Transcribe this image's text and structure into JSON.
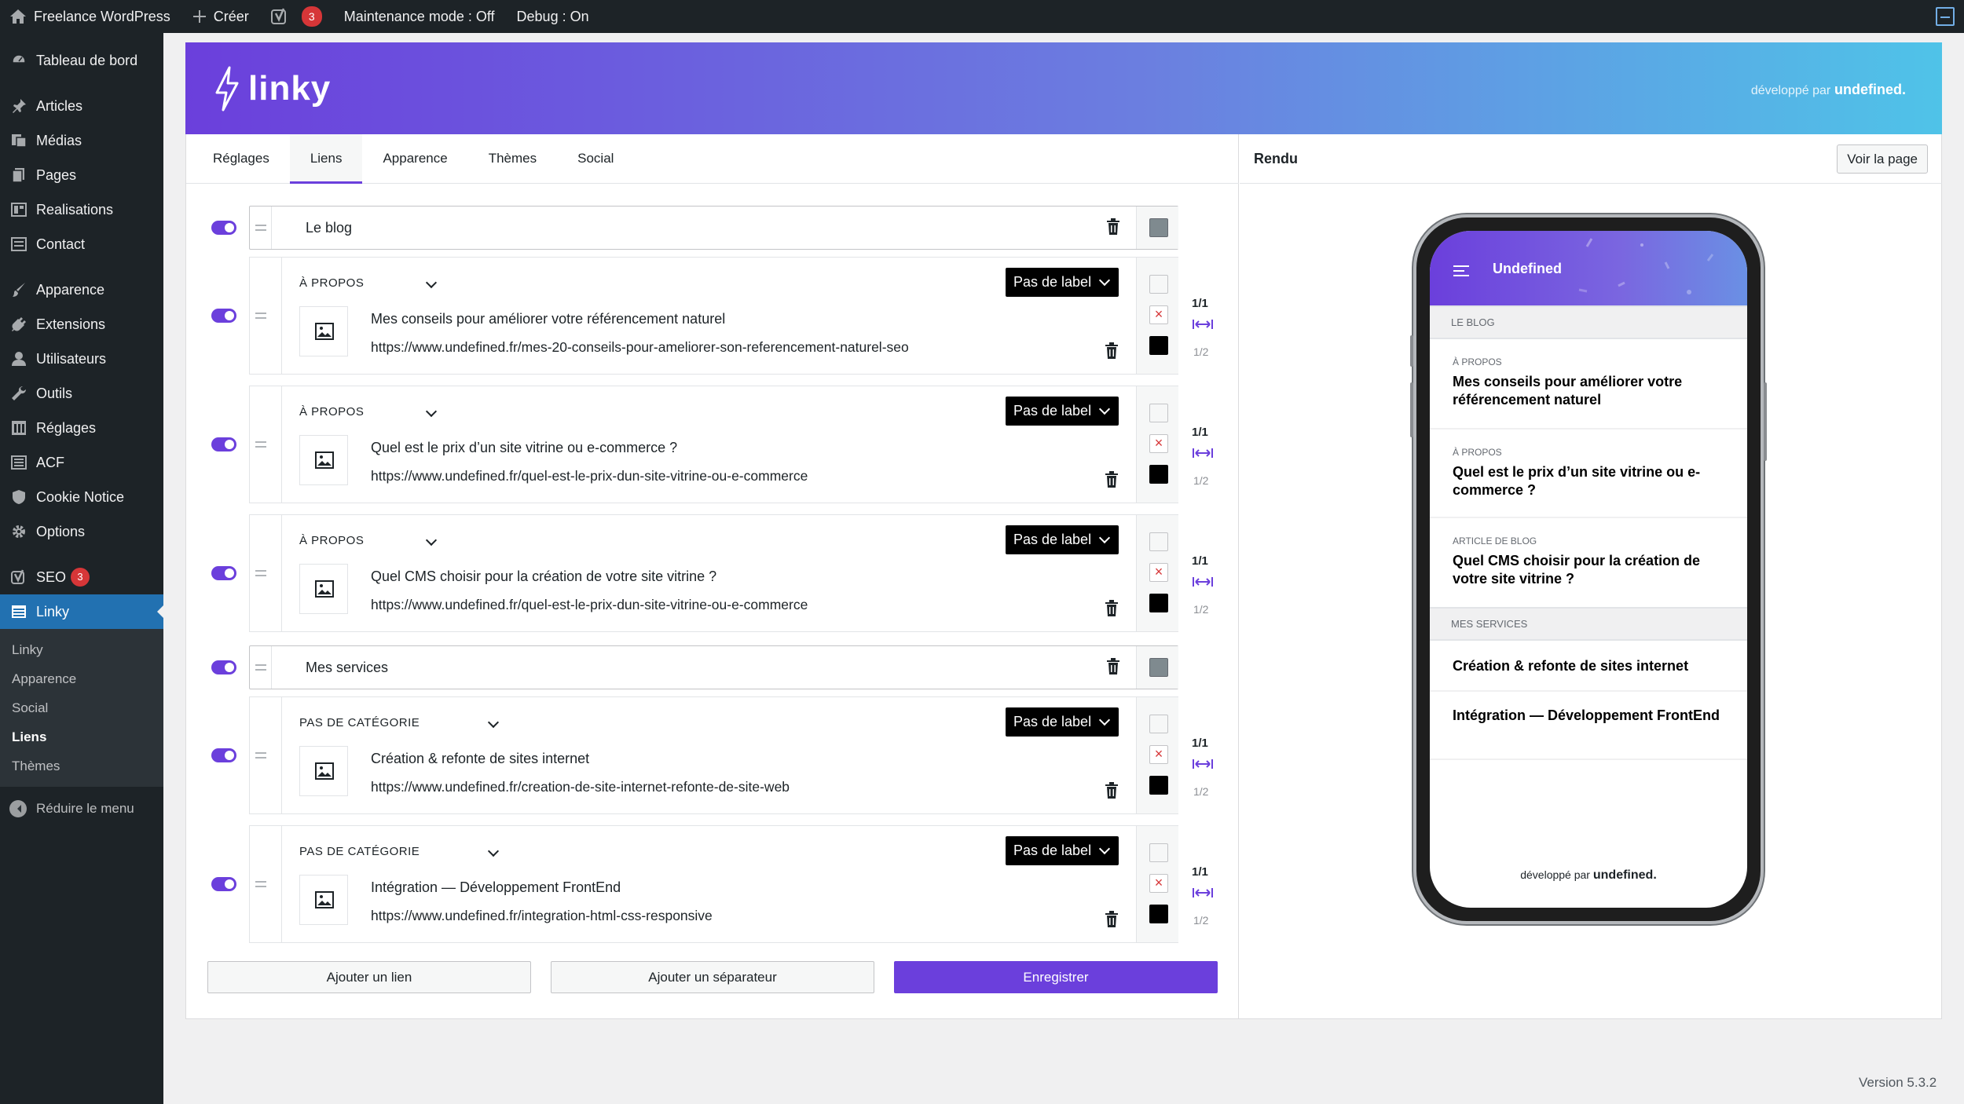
{
  "adminbar": {
    "site_name": "Freelance WordPress",
    "create": "Créer",
    "seo_count": "3",
    "maintenance": "Maintenance mode : Off",
    "debug": "Debug : On"
  },
  "sidebar": {
    "items": [
      {
        "label": "Tableau de bord",
        "icon": "dashboard-icon"
      },
      {
        "label": "Articles",
        "icon": "pin-icon"
      },
      {
        "label": "Médias",
        "icon": "media-icon"
      },
      {
        "label": "Pages",
        "icon": "pages-icon"
      },
      {
        "label": "Realisations",
        "icon": "realisations-icon"
      },
      {
        "label": "Contact",
        "icon": "contact-icon"
      },
      {
        "label": "Apparence",
        "icon": "brush-icon"
      },
      {
        "label": "Extensions",
        "icon": "plugin-icon"
      },
      {
        "label": "Utilisateurs",
        "icon": "users-icon"
      },
      {
        "label": "Outils",
        "icon": "wrench-icon"
      },
      {
        "label": "Réglages",
        "icon": "settings-icon"
      },
      {
        "label": "ACF",
        "icon": "acf-icon"
      },
      {
        "label": "Cookie Notice",
        "icon": "shield-icon"
      },
      {
        "label": "Options",
        "icon": "gear-icon"
      },
      {
        "label": "SEO",
        "icon": "yoast-icon",
        "badge": "3"
      },
      {
        "label": "Linky",
        "icon": "linky-icon"
      }
    ],
    "submenu": [
      "Linky",
      "Apparence",
      "Social",
      "Liens",
      "Thèmes"
    ],
    "collapse": "Réduire le menu"
  },
  "banner": {
    "logo": "linky",
    "credit_prefix": "développé par",
    "credit_brand": "undefined."
  },
  "tabs": [
    "Réglages",
    "Liens",
    "Apparence",
    "Thèmes",
    "Social"
  ],
  "editor": {
    "separators": [
      "Le blog",
      "Mes services"
    ],
    "links": [
      {
        "category": "À PROPOS",
        "label": "Pas de label",
        "title": "Mes conseils pour améliorer votre référencement naturel",
        "url": "https://www.undefined.fr/mes-20-conseils-pour-ameliorer-son-referencement-naturel-seo",
        "width_full": "1/1",
        "width_half": "1/2"
      },
      {
        "category": "À PROPOS",
        "label": "Pas de label",
        "title": "Quel est le prix d’un site vitrine ou e-commerce ?",
        "url": "https://www.undefined.fr/quel-est-le-prix-dun-site-vitrine-ou-e-commerce",
        "width_full": "1/1",
        "width_half": "1/2"
      },
      {
        "category": "À PROPOS",
        "label": "Pas de label",
        "title": "Quel CMS choisir pour la création de votre site vitrine ?",
        "url": "https://www.undefined.fr/quel-est-le-prix-dun-site-vitrine-ou-e-commerce",
        "width_full": "1/1",
        "width_half": "1/2"
      },
      {
        "category": "PAS DE CATÉGORIE",
        "label": "Pas de label",
        "title": "Création & refonte de sites internet",
        "url": "https://www.undefined.fr/creation-de-site-internet-refonte-de-site-web",
        "width_full": "1/1",
        "width_half": "1/2"
      },
      {
        "category": "PAS DE CATÉGORIE",
        "label": "Pas de label",
        "title": "Intégration — Développement FrontEnd",
        "url": "https://www.undefined.fr/integration-html-css-responsive",
        "width_full": "1/1",
        "width_half": "1/2"
      }
    ],
    "buttons": {
      "add_link": "Ajouter un lien",
      "add_separator": "Ajouter un séparateur",
      "save": "Enregistrer"
    }
  },
  "preview": {
    "title": "Rendu",
    "view_page": "Voir la page",
    "phone": {
      "site_name": "Undefined",
      "sep1": "LE BLOG",
      "links": [
        {
          "category": "À PROPOS",
          "title": "Mes conseils pour améliorer votre référencement naturel"
        },
        {
          "category": "À PROPOS",
          "title": "Quel est le prix d’un site vitrine ou e-commerce ?"
        },
        {
          "category": "ARTICLE DE BLOG",
          "title": "Quel CMS choisir pour la création de votre site vitrine ?"
        }
      ],
      "sep2": "MES SERVICES",
      "services": [
        "Création & refonte de sites internet",
        "Intégration — Développement FrontEnd"
      ],
      "footer_prefix": "développé par",
      "footer_brand": "undefined."
    }
  },
  "version": "Version 5.3.2",
  "colors": {
    "accent": "#6b3fdc",
    "admin_bg": "#1d2327",
    "menu_current": "#2271b1",
    "badge": "#d63638"
  }
}
